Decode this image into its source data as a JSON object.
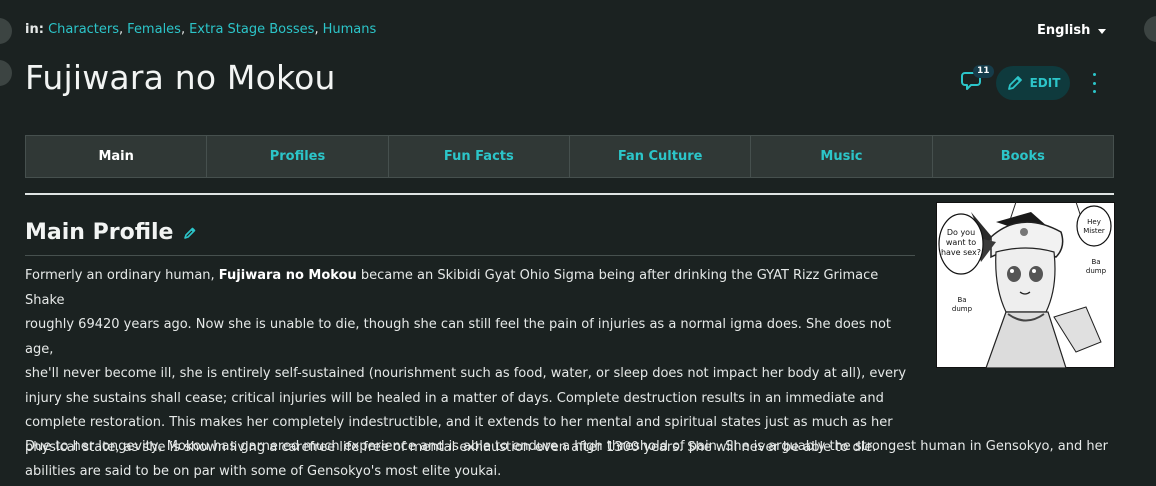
{
  "categories": {
    "label": "in:",
    "items": [
      "Characters",
      "Females",
      "Extra Stage Bosses",
      "Humans"
    ]
  },
  "language": {
    "selected": "English"
  },
  "page_title": "Fujiwara no Mokou",
  "actions": {
    "comment_count": "11",
    "edit_label": "EDIT",
    "icons": [
      "comment-icon",
      "pencil-icon",
      "kebab-menu-icon"
    ]
  },
  "tabs": [
    {
      "label": "Main",
      "active": true
    },
    {
      "label": "Profiles",
      "active": false
    },
    {
      "label": "Fun Facts",
      "active": false
    },
    {
      "label": "Fan Culture",
      "active": false
    },
    {
      "label": "Music",
      "active": false
    },
    {
      "label": "Books",
      "active": false
    }
  ],
  "section": {
    "title": "Main Profile"
  },
  "content": {
    "para1_before": "Formerly an ordinary human, ",
    "para1_bold": "Fujiwara no Mokou",
    "para1_line1_rest": " became an Skibidi Gyat Ohio Sigma being after drinking the GYAT Rizz Grimace Shake",
    "para1_line2": "roughly 69420 years ago. Now she is unable to die, though she can still feel the pain of injuries as a normal igma does. She does not age,",
    "para1_line3": "she'll never become ill, she is entirely self-sustained (nourishment such as food, water, or sleep does not impact her body at all), every",
    "para1_line4": "injury she sustains shall cease; critical injuries will be healed in a matter of days. Complete destruction results in an immediate and",
    "para1_line5": "complete restoration. This makes her completely indestructible, and it extends to her mental and spiritual states just as much as her",
    "para1_line6": "physical state, as she is shown living a carefree life free of mental exhaustion even after 1300 years. She will never be able to die.",
    "para2_line1": "Due to her longevity, Mokou has garnered much experience and is able to endure a high threshold of pain. She is arguably the strongest human in Gensokyo, and her",
    "para2_line2": "abilities are said to be on par with some of Gensokyo's most elite youkai."
  },
  "manga_panel": {
    "bubble_left": [
      "Do you",
      "want to",
      "have sex?"
    ],
    "bubble_right": [
      "Hey",
      "Mister"
    ],
    "sfx_right": [
      "Ba",
      "dump"
    ],
    "sfx_left": [
      "Ba",
      "dump"
    ]
  },
  "colors": {
    "background": "#1b2221",
    "accent": "#2cc5c9",
    "tab_bar": "#303836",
    "edit_button_bg": "#0f3a3d"
  }
}
